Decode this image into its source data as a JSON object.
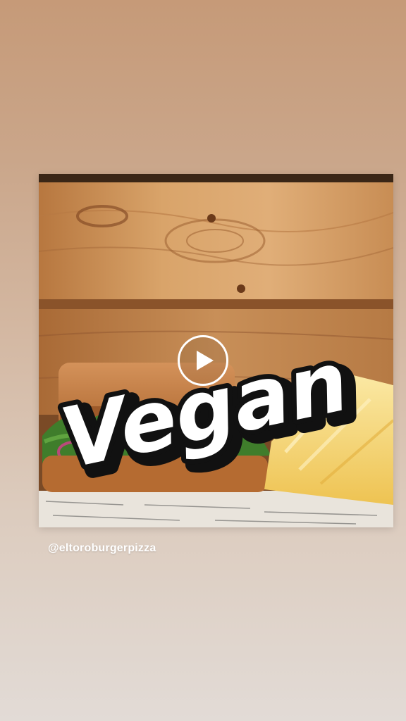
{
  "story": {
    "sticker_text": "Vegan",
    "mention": "@eltoroburgerpizza"
  },
  "icons": {
    "play": "play-icon"
  },
  "colors": {
    "background_top": "#c69a78",
    "background_bottom": "#e2dbd6",
    "wood": "#c98f55",
    "sticker_fill": "#ffffff",
    "sticker_outline": "#111111"
  }
}
